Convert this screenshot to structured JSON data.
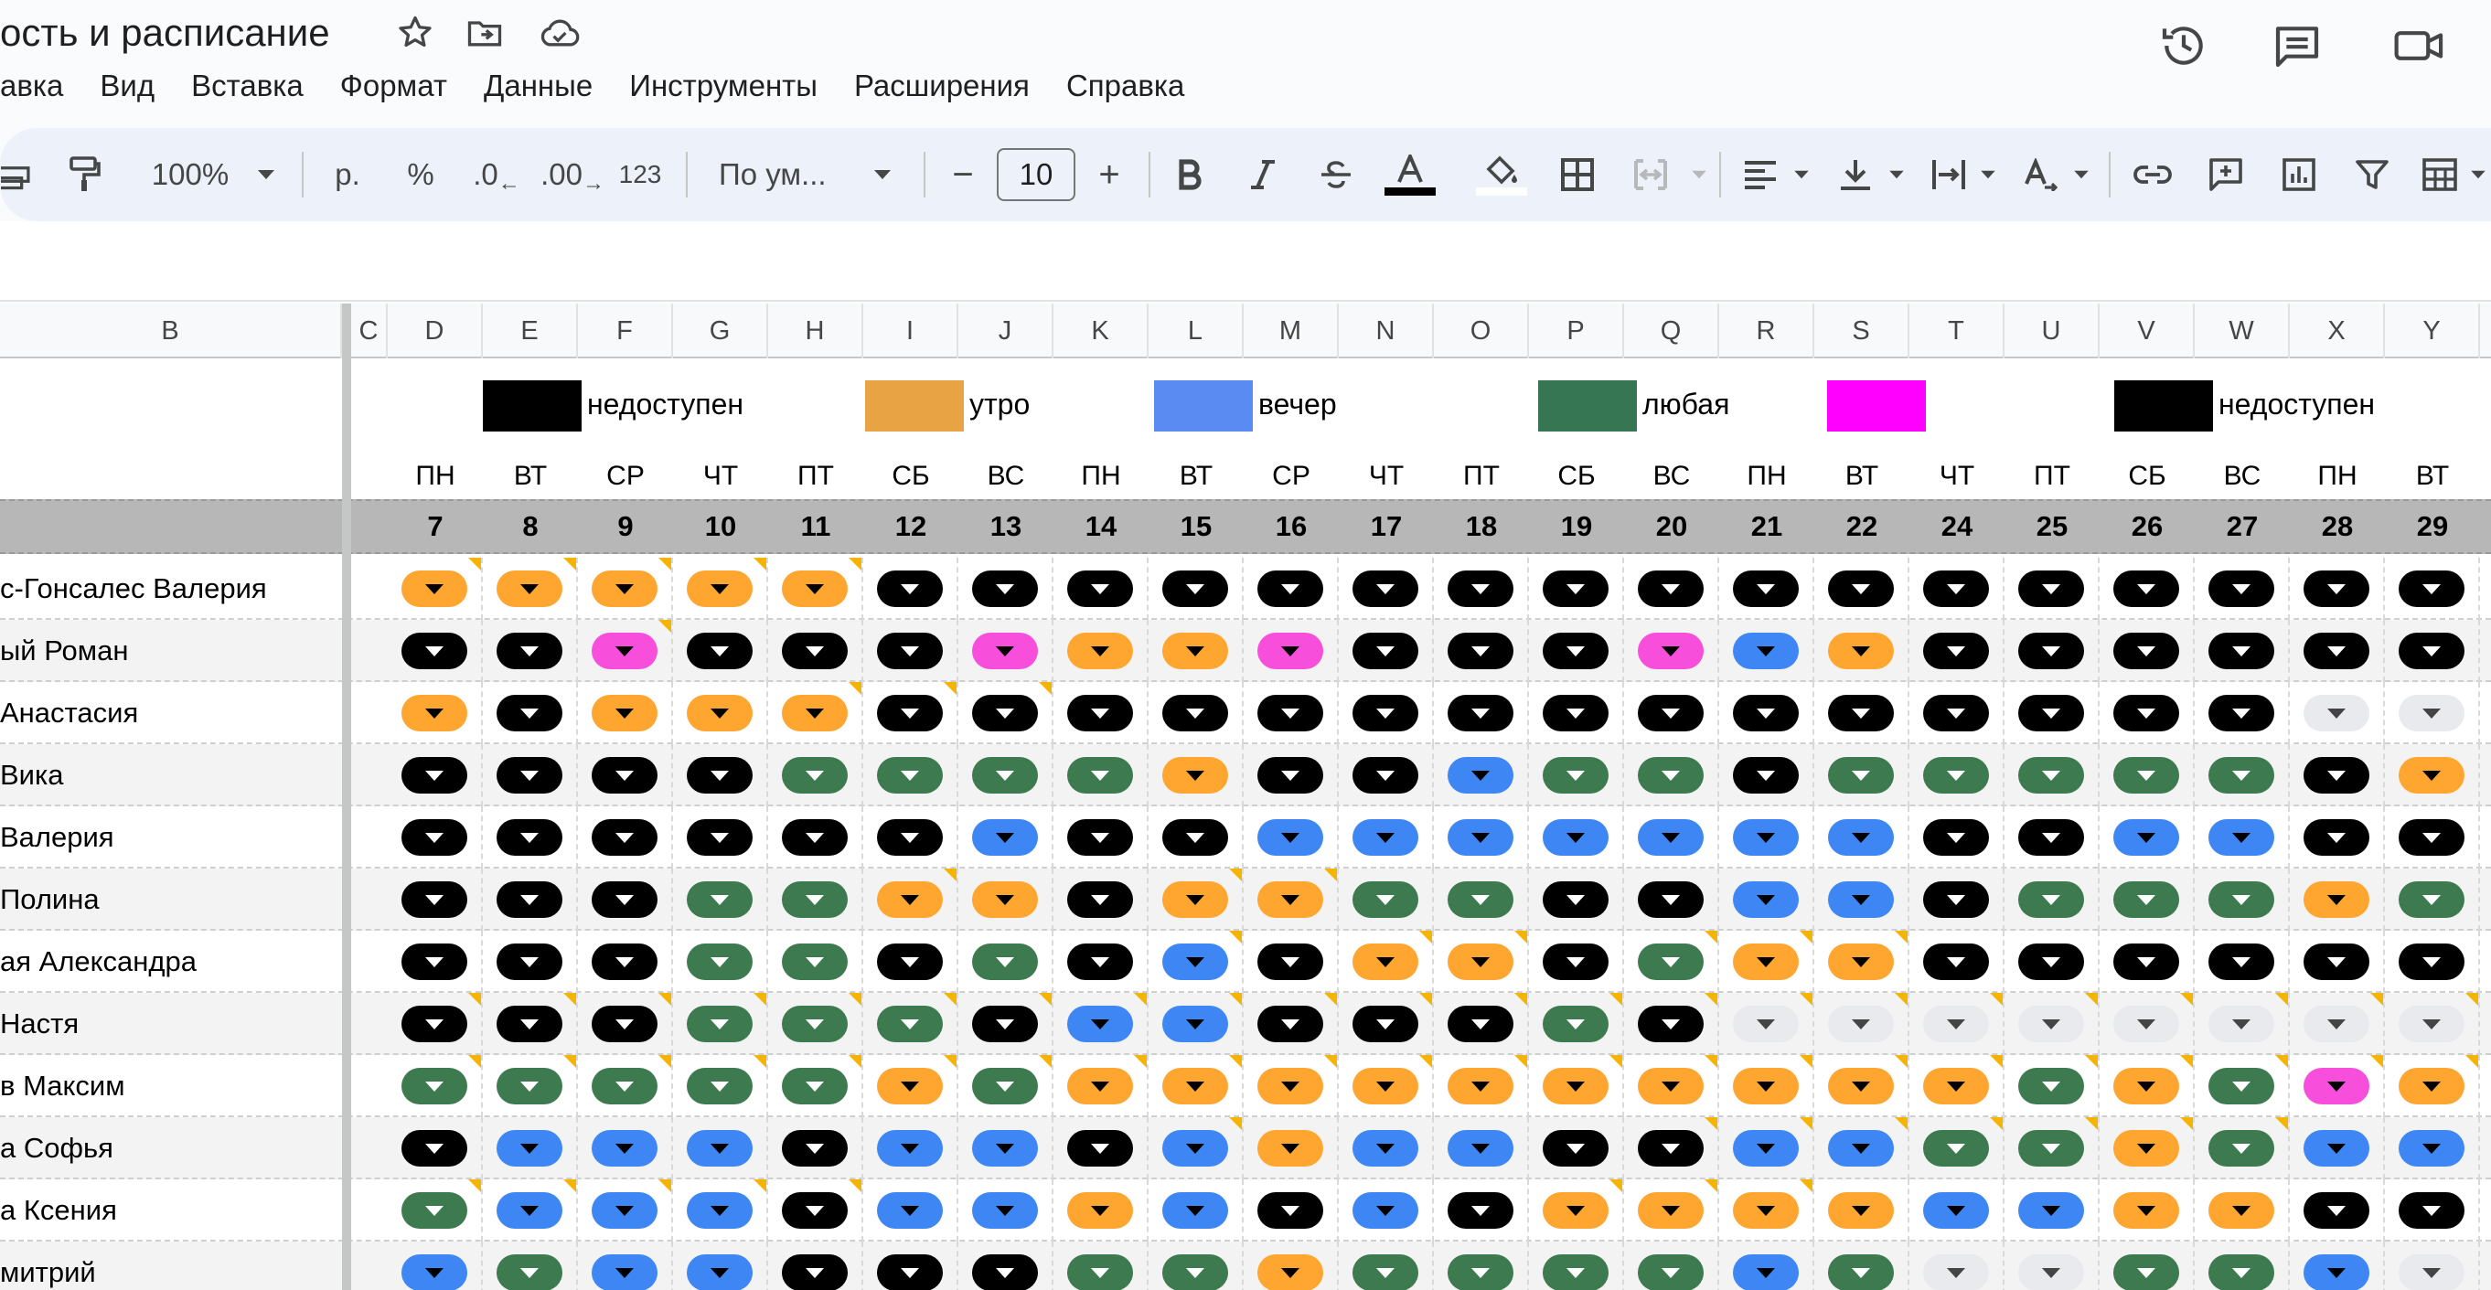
{
  "doc": {
    "title": "ость и расписание"
  },
  "menu": [
    "авка",
    "Вид",
    "Вставка",
    "Формат",
    "Данные",
    "Инструменты",
    "Расширения",
    "Справка"
  ],
  "toolbar": {
    "zoom": "100%",
    "currency": "р.",
    "percent": "%",
    "dec_decrease": ".0",
    "dec_increase": ".00",
    "number_format": "123",
    "font": "По ум...",
    "font_size": "10",
    "minus": "−",
    "plus": "+"
  },
  "columns": [
    "B",
    "C",
    "D",
    "E",
    "F",
    "G",
    "H",
    "I",
    "J",
    "K",
    "L",
    "M",
    "N",
    "O",
    "P",
    "Q",
    "R",
    "S",
    "T",
    "U",
    "V",
    "W",
    "X",
    "Y"
  ],
  "legend": [
    {
      "label": "недоступен",
      "color": "#000000"
    },
    {
      "label": "утро",
      "color": "#e8a344"
    },
    {
      "label": "вечер",
      "color": "#5a8bf2"
    },
    {
      "label": "любая",
      "color": "#377652"
    },
    {
      "label": "",
      "color": "#ff00ff"
    },
    {
      "label": "недоступен",
      "color": "#000000"
    }
  ],
  "days_of_week": [
    "ПН",
    "ВТ",
    "СР",
    "ЧТ",
    "ПТ",
    "СБ",
    "ВС",
    "ПН",
    "ВТ",
    "СР",
    "ЧТ",
    "ПТ",
    "СБ",
    "ВС",
    "ПН",
    "ВТ",
    "ЧТ",
    "ПТ",
    "СБ",
    "ВС",
    "ПН",
    "ВТ"
  ],
  "dates": [
    "7",
    "8",
    "9",
    "10",
    "11",
    "12",
    "13",
    "14",
    "15",
    "16",
    "17",
    "18",
    "19",
    "20",
    "21",
    "22",
    "24",
    "25",
    "26",
    "27",
    "28",
    "29"
  ],
  "people": [
    {
      "name": "с-Гонсалес Валерия",
      "cells": [
        "orange",
        "orange",
        "orange",
        "orange",
        "orange",
        "black",
        "black",
        "black",
        "black",
        "black",
        "black",
        "black",
        "black",
        "black",
        "black",
        "black",
        "black",
        "black",
        "black",
        "black",
        "black",
        "black"
      ]
    },
    {
      "name": "ый Роман",
      "cells": [
        "black",
        "black",
        "pink",
        "black",
        "black",
        "black",
        "pink",
        "orange",
        "orange",
        "pink",
        "black",
        "black",
        "black",
        "pink",
        "blue",
        "orange",
        "black",
        "black",
        "black",
        "black",
        "black",
        "black"
      ]
    },
    {
      "name": " Анастасия",
      "cells": [
        "orange",
        "black",
        "orange",
        "orange",
        "orange",
        "black",
        "black",
        "black",
        "black",
        "black",
        "black",
        "black",
        "black",
        "black",
        "black",
        "black",
        "black",
        "black",
        "black",
        "black",
        "grey",
        "grey"
      ]
    },
    {
      "name": " Вика",
      "cells": [
        "black",
        "black",
        "black",
        "black",
        "green",
        "green",
        "green",
        "green",
        "orange",
        "black",
        "black",
        "blue",
        "green",
        "green",
        "black",
        "green",
        "green",
        "green",
        "green",
        "green",
        "black",
        "orange"
      ]
    },
    {
      "name": " Валерия",
      "cells": [
        "black",
        "black",
        "black",
        "black",
        "black",
        "black",
        "blue",
        "black",
        "black",
        "blue",
        "blue",
        "blue",
        "blue",
        "blue",
        "blue",
        "blue",
        "black",
        "black",
        "blue",
        "blue",
        "black",
        "black"
      ]
    },
    {
      "name": "Полина",
      "cells": [
        "black",
        "black",
        "black",
        "green",
        "green",
        "orange",
        "orange",
        "black",
        "orange",
        "orange",
        "green",
        "green",
        "black",
        "black",
        "blue",
        "blue",
        "black",
        "green",
        "green",
        "green",
        "orange",
        "green"
      ]
    },
    {
      "name": "ая Александра",
      "cells": [
        "black",
        "black",
        "black",
        "green",
        "green",
        "black",
        "green",
        "black",
        "blue",
        "black",
        "orange",
        "orange",
        "black",
        "green",
        "orange",
        "orange",
        "black",
        "black",
        "black",
        "black",
        "black",
        "black"
      ]
    },
    {
      "name": "Настя",
      "cells": [
        "black",
        "black",
        "black",
        "green",
        "green",
        "green",
        "black",
        "blue",
        "blue",
        "black",
        "black",
        "black",
        "green",
        "black",
        "grey",
        "grey",
        "grey",
        "grey",
        "grey",
        "grey",
        "grey",
        "grey"
      ]
    },
    {
      "name": "в Максим",
      "cells": [
        "green",
        "green",
        "green",
        "green",
        "green",
        "orange",
        "green",
        "orange",
        "orange",
        "orange",
        "orange",
        "orange",
        "orange",
        "orange",
        "orange",
        "orange",
        "orange",
        "green",
        "orange",
        "green",
        "pink",
        "orange"
      ]
    },
    {
      "name": "а Софья",
      "cells": [
        "black",
        "blue",
        "blue",
        "blue",
        "black",
        "blue",
        "blue",
        "black",
        "blue",
        "orange",
        "blue",
        "blue",
        "black",
        "black",
        "blue",
        "blue",
        "green",
        "green",
        "orange",
        "green",
        "blue",
        "blue"
      ]
    },
    {
      "name": "а Ксения",
      "cells": [
        "green",
        "blue",
        "blue",
        "blue",
        "black",
        "blue",
        "blue",
        "orange",
        "blue",
        "black",
        "blue",
        "black",
        "orange",
        "orange",
        "orange",
        "orange",
        "blue",
        "blue",
        "orange",
        "orange",
        "black",
        "black"
      ]
    },
    {
      "name": "митрий",
      "cells": [
        "blue",
        "green",
        "blue",
        "blue",
        "black",
        "black",
        "black",
        "green",
        "green",
        "orange",
        "green",
        "green",
        "green",
        "green",
        "blue",
        "green",
        "grey",
        "grey",
        "green",
        "green",
        "blue",
        "grey"
      ]
    }
  ]
}
